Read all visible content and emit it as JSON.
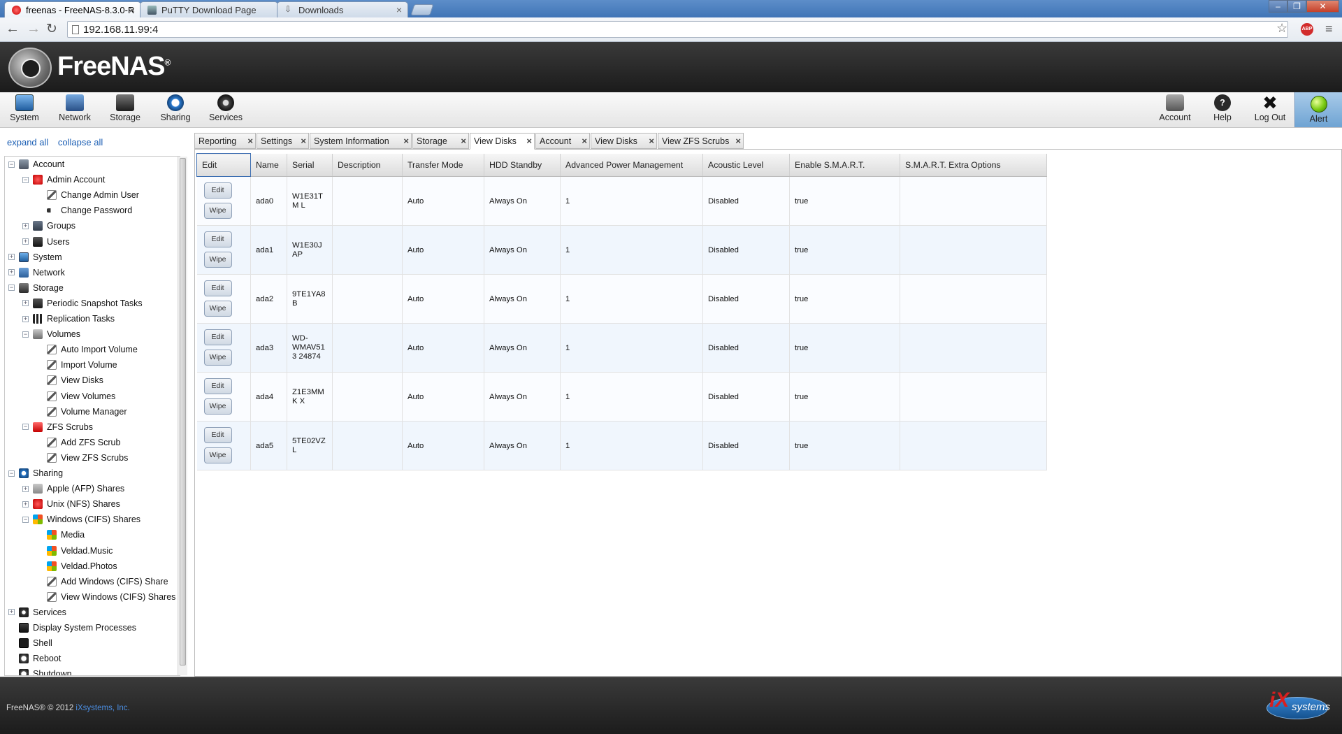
{
  "browser": {
    "tabs": [
      {
        "title": "freenas - FreeNAS-8.3.0-R",
        "active": true
      },
      {
        "title": "PuTTY Download Page",
        "active": false
      },
      {
        "title": "Downloads",
        "active": false
      }
    ],
    "url": "192.168.11.99:4",
    "abp_label": "ABP"
  },
  "header": {
    "brand": "FreeNAS",
    "registered": "®"
  },
  "toolbar": {
    "left": [
      {
        "label": "System",
        "icon": "system-icon"
      },
      {
        "label": "Network",
        "icon": "network-icon"
      },
      {
        "label": "Storage",
        "icon": "storage-icon"
      },
      {
        "label": "Sharing",
        "icon": "sharing-icon"
      },
      {
        "label": "Services",
        "icon": "services-icon"
      }
    ],
    "right": [
      {
        "label": "Account",
        "icon": "account-icon"
      },
      {
        "label": "Help",
        "icon": "help-icon"
      },
      {
        "label": "Log Out",
        "icon": "logout-icon"
      },
      {
        "label": "Alert",
        "icon": "alert-icon"
      }
    ]
  },
  "sidebar": {
    "expand_all": "expand all",
    "collapse_all": "collapse all",
    "tree": [
      {
        "label": "Account",
        "level": 0,
        "state": "open"
      },
      {
        "label": "Admin Account",
        "level": 1,
        "state": "open"
      },
      {
        "label": "Change Admin User",
        "level": 2,
        "state": "leaf"
      },
      {
        "label": "Change Password",
        "level": 2,
        "state": "leaf"
      },
      {
        "label": "Groups",
        "level": 1,
        "state": "closed"
      },
      {
        "label": "Users",
        "level": 1,
        "state": "closed"
      },
      {
        "label": "System",
        "level": 0,
        "state": "closed"
      },
      {
        "label": "Network",
        "level": 0,
        "state": "closed"
      },
      {
        "label": "Storage",
        "level": 0,
        "state": "open"
      },
      {
        "label": "Periodic Snapshot Tasks",
        "level": 1,
        "state": "closed"
      },
      {
        "label": "Replication Tasks",
        "level": 1,
        "state": "closed"
      },
      {
        "label": "Volumes",
        "level": 1,
        "state": "open"
      },
      {
        "label": "Auto Import Volume",
        "level": 2,
        "state": "leaf"
      },
      {
        "label": "Import Volume",
        "level": 2,
        "state": "leaf"
      },
      {
        "label": "View Disks",
        "level": 2,
        "state": "leaf"
      },
      {
        "label": "View Volumes",
        "level": 2,
        "state": "leaf"
      },
      {
        "label": "Volume Manager",
        "level": 2,
        "state": "leaf"
      },
      {
        "label": "ZFS Scrubs",
        "level": 1,
        "state": "open"
      },
      {
        "label": "Add ZFS Scrub",
        "level": 2,
        "state": "leaf"
      },
      {
        "label": "View ZFS Scrubs",
        "level": 2,
        "state": "leaf"
      },
      {
        "label": "Sharing",
        "level": 0,
        "state": "open"
      },
      {
        "label": "Apple (AFP) Shares",
        "level": 1,
        "state": "closed"
      },
      {
        "label": "Unix (NFS) Shares",
        "level": 1,
        "state": "closed"
      },
      {
        "label": "Windows (CIFS) Shares",
        "level": 1,
        "state": "open"
      },
      {
        "label": "Media",
        "level": 2,
        "state": "leaf"
      },
      {
        "label": "Veldad.Music",
        "level": 2,
        "state": "leaf"
      },
      {
        "label": "Veldad.Photos",
        "level": 2,
        "state": "leaf"
      },
      {
        "label": "Add Windows (CIFS) Share",
        "level": 2,
        "state": "leaf"
      },
      {
        "label": "View Windows (CIFS) Shares",
        "level": 2,
        "state": "leaf"
      },
      {
        "label": "Services",
        "level": 0,
        "state": "closed"
      },
      {
        "label": "Display System Processes",
        "level": 0,
        "state": "none"
      },
      {
        "label": "Shell",
        "level": 0,
        "state": "none"
      },
      {
        "label": "Reboot",
        "level": 0,
        "state": "none"
      },
      {
        "label": "Shutdown",
        "level": 0,
        "state": "none"
      }
    ]
  },
  "tabs": [
    {
      "label": "Reporting",
      "active": false
    },
    {
      "label": "Settings",
      "active": false
    },
    {
      "label": "System Information",
      "active": false
    },
    {
      "label": "Storage",
      "active": false
    },
    {
      "label": "View Disks",
      "active": true
    },
    {
      "label": "Account",
      "active": false
    },
    {
      "label": "View Disks",
      "active": false
    },
    {
      "label": "View ZFS Scrubs",
      "active": false
    }
  ],
  "grid": {
    "columns": [
      "Edit",
      "Name",
      "Serial",
      "Description",
      "Transfer Mode",
      "HDD Standby",
      "Advanced Power Management",
      "Acoustic Level",
      "Enable S.M.A.R.T.",
      "S.M.A.R.T. Extra Options"
    ],
    "edit_button": "Edit",
    "wipe_button": "Wipe",
    "rows": [
      {
        "name": "ada0",
        "serial": "W1E31TM L",
        "description": "",
        "transfer_mode": "Auto",
        "hdd_standby": "Always On",
        "apm": "1",
        "acoustic": "Disabled",
        "smart": "true",
        "smart_opts": ""
      },
      {
        "name": "ada1",
        "serial": "W1E30JAP",
        "description": "",
        "transfer_mode": "Auto",
        "hdd_standby": "Always On",
        "apm": "1",
        "acoustic": "Disabled",
        "smart": "true",
        "smart_opts": ""
      },
      {
        "name": "ada2",
        "serial": "9TE1YA8B",
        "description": "",
        "transfer_mode": "Auto",
        "hdd_standby": "Always On",
        "apm": "1",
        "acoustic": "Disabled",
        "smart": "true",
        "smart_opts": ""
      },
      {
        "name": "ada3",
        "serial": "WD- WMAV513 24874",
        "description": "",
        "transfer_mode": "Auto",
        "hdd_standby": "Always On",
        "apm": "1",
        "acoustic": "Disabled",
        "smart": "true",
        "smart_opts": ""
      },
      {
        "name": "ada4",
        "serial": "Z1E3MMK X",
        "description": "",
        "transfer_mode": "Auto",
        "hdd_standby": "Always On",
        "apm": "1",
        "acoustic": "Disabled",
        "smart": "true",
        "smart_opts": ""
      },
      {
        "name": "ada5",
        "serial": "5TE02VZL",
        "description": "",
        "transfer_mode": "Auto",
        "hdd_standby": "Always On",
        "apm": "1",
        "acoustic": "Disabled",
        "smart": "true",
        "smart_opts": ""
      }
    ]
  },
  "footer": {
    "copyright": "FreeNAS® © 2012",
    "company": "iXsystems, Inc.",
    "logo_ix": "iX",
    "logo_systems": "systems"
  },
  "colors": {
    "header_bg": "#1b1b1b",
    "alert_green": "#7acb14",
    "link_blue": "#1c5fb4",
    "row_alt": "#f0f6fd"
  }
}
